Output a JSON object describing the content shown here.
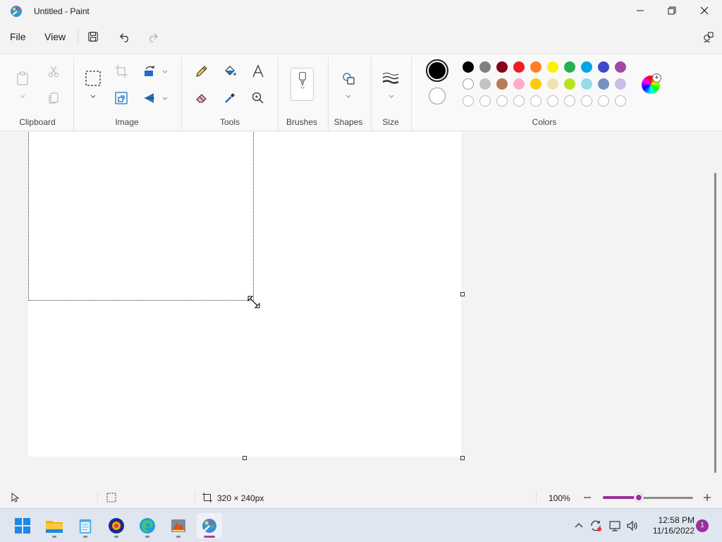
{
  "window": {
    "title": "Untitled - Paint",
    "icon": "paint-app-icon"
  },
  "menu": {
    "file": "File",
    "view": "View",
    "icons": [
      "save-icon",
      "undo-icon",
      "redo-icon",
      "share-icon"
    ]
  },
  "ribbon": {
    "groups": {
      "clipboard": "Clipboard",
      "image": "Image",
      "tools": "Tools",
      "brushes": "Brushes",
      "shapes": "Shapes",
      "size": "Size",
      "colors": "Colors"
    }
  },
  "colors": {
    "primary": "#000000",
    "secondary": "#ffffff",
    "palette_row1": [
      "#000000",
      "#7f7f7f",
      "#880015",
      "#ed1c24",
      "#ff7f27",
      "#fff200",
      "#22b14c",
      "#00a2e8",
      "#3f48cc",
      "#a349a4"
    ],
    "palette_row2": [
      "#ffffff",
      "#c3c3c3",
      "#b97a57",
      "#ffaec9",
      "#ffc90e",
      "#efe4b0",
      "#b5e61d",
      "#99d9ea",
      "#7092be",
      "#c8bfe7"
    ],
    "palette_row3_empty_count": 10,
    "accent": "#9b2f9b"
  },
  "status": {
    "canvas_size": "320 × 240px",
    "zoom": "100%",
    "zoom_level_fraction": 0.4
  },
  "taskbar": {
    "apps": [
      "start-icon",
      "file-explorer-icon",
      "notepad-icon",
      "app-icon",
      "edge-icon",
      "app-icon-2",
      "paint-icon"
    ],
    "time": "12:58 PM",
    "date": "11/16/2022",
    "notifications": "1"
  }
}
